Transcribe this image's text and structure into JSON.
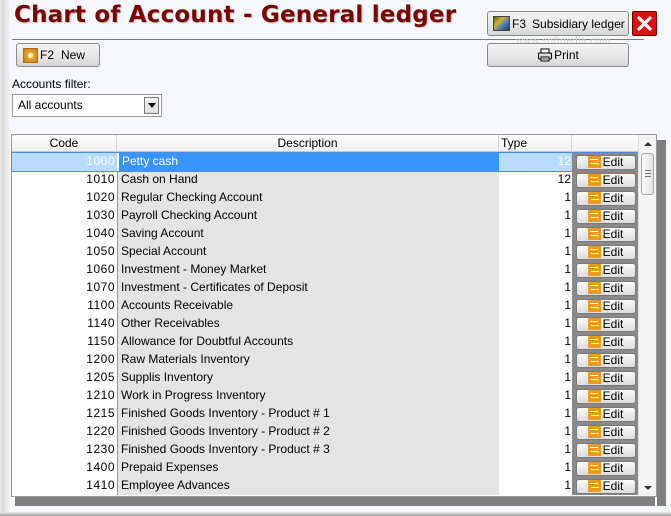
{
  "window": {
    "title": "Chart of Account - General ledger",
    "watermark": "www.softpedia.com"
  },
  "toolbar": {
    "new_button": {
      "shortcut": "F2",
      "label": "New",
      "icon": "new-sparkle-icon"
    },
    "subsidiary_button": {
      "shortcut": "F3",
      "label": "Subsidiary ledger",
      "icon": "ledger-image-icon"
    },
    "print_button": {
      "label": "Print",
      "icon": "printer-icon"
    },
    "close_button": {
      "icon": "close-x-icon",
      "color": "#e01010"
    }
  },
  "filter": {
    "label": "Accounts filter:",
    "selected": "All accounts"
  },
  "table": {
    "columns": [
      "Code",
      "Description",
      "Type",
      ""
    ],
    "edit_label": "Edit",
    "selected_index": 0,
    "rows": [
      {
        "code": "1000",
        "description": "Petty cash",
        "type": "12"
      },
      {
        "code": "1010",
        "description": "Cash on Hand",
        "type": "12"
      },
      {
        "code": "1020",
        "description": "Regular Checking Account",
        "type": "1"
      },
      {
        "code": "1030",
        "description": "Payroll Checking Account",
        "type": "1"
      },
      {
        "code": "1040",
        "description": "Saving Account",
        "type": "1"
      },
      {
        "code": "1050",
        "description": "Special Account",
        "type": "1"
      },
      {
        "code": "1060",
        "description": "Investment - Money Market",
        "type": "1"
      },
      {
        "code": "1070",
        "description": "Investment - Certificates of Deposit",
        "type": "1"
      },
      {
        "code": "1100",
        "description": "Accounts Receivable",
        "type": "1"
      },
      {
        "code": "1140",
        "description": "Other Receivables",
        "type": "1"
      },
      {
        "code": "1150",
        "description": "Allowance for Doubtful Accounts",
        "type": "1"
      },
      {
        "code": "1200",
        "description": "Raw Materials Inventory",
        "type": "1"
      },
      {
        "code": "1205",
        "description": "Supplis Inventory",
        "type": "1"
      },
      {
        "code": "1210",
        "description": "Work in Progress Inventory",
        "type": "1"
      },
      {
        "code": "1215",
        "description": "Finished Goods Inventory - Product # 1",
        "type": "1"
      },
      {
        "code": "1220",
        "description": "Finished Goods Inventory - Product # 2",
        "type": "1"
      },
      {
        "code": "1230",
        "description": "Finished Goods Inventory - Product # 3",
        "type": "1"
      },
      {
        "code": "1400",
        "description": "Prepaid Expenses",
        "type": "1"
      },
      {
        "code": "1410",
        "description": "Employee Advances",
        "type": "1"
      }
    ]
  },
  "colors": {
    "title": "#7b0000",
    "selection": "#3a94ff",
    "selection_light": "#b8dcff",
    "edit_icon": "#ef9a1e"
  }
}
